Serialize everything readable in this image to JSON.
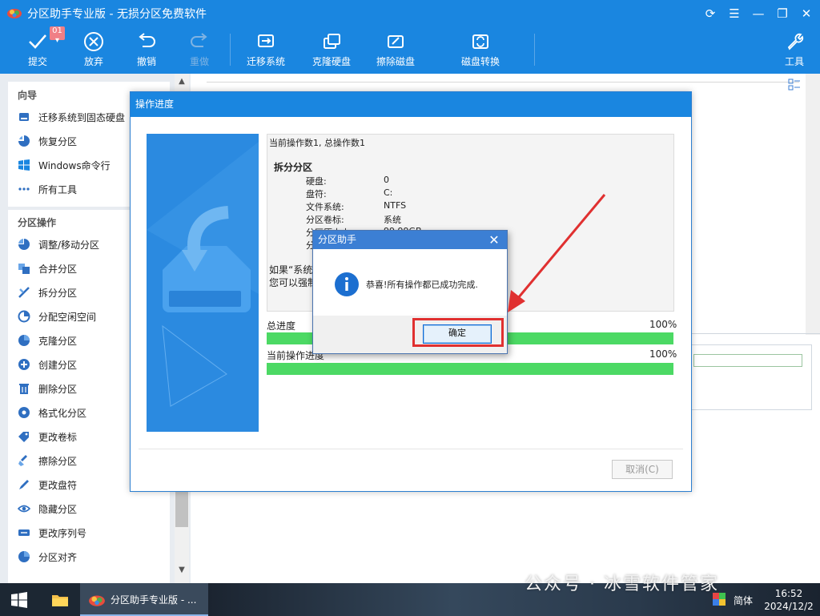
{
  "window": {
    "title": "分区助手专业版 - 无损分区免费软件",
    "controls": [
      "refresh-icon",
      "menu-icon",
      "minimize-icon",
      "restore-icon",
      "close-icon"
    ]
  },
  "toolbar": {
    "commit_label": "提交",
    "pending_badge": "01",
    "discard_label": "放弃",
    "undo_label": "撤销",
    "redo_label": "重做",
    "migrate_label": "迁移系统",
    "clone_label": "克隆硬盘",
    "wipe_label": "擦除磁盘",
    "convert_label": "磁盘转换",
    "tools_label": "工具"
  },
  "sidebar": {
    "wizard_header": "向导",
    "wizard_items": [
      {
        "label": "迁移系统到固态硬盘",
        "icon": "migrate-ssd-icon"
      },
      {
        "label": "恢复分区",
        "icon": "recover-partition-icon"
      },
      {
        "label": "Windows命令行",
        "icon": "windows-icon"
      },
      {
        "label": "所有工具",
        "icon": "more-dots-icon"
      }
    ],
    "ops_header": "分区操作",
    "ops_items": [
      {
        "label": "调整/移动分区",
        "icon": "resize-partition-icon"
      },
      {
        "label": "合并分区",
        "icon": "merge-partition-icon"
      },
      {
        "label": "拆分分区",
        "icon": "split-partition-icon"
      },
      {
        "label": "分配空闲空间",
        "icon": "allocate-space-icon"
      },
      {
        "label": "克隆分区",
        "icon": "clone-partition-icon"
      },
      {
        "label": "创建分区",
        "icon": "create-partition-icon"
      },
      {
        "label": "删除分区",
        "icon": "delete-partition-icon"
      },
      {
        "label": "格式化分区",
        "icon": "format-partition-icon"
      },
      {
        "label": "更改卷标",
        "icon": "label-tag-icon"
      },
      {
        "label": "擦除分区",
        "icon": "wipe-partition-icon"
      },
      {
        "label": "更改盘符",
        "icon": "drive-letter-icon"
      },
      {
        "label": "隐藏分区",
        "icon": "hide-partition-icon"
      },
      {
        "label": "更改序列号",
        "icon": "serial-number-icon"
      },
      {
        "label": "分区对齐",
        "icon": "align-partition-icon"
      }
    ]
  },
  "progress_dialog": {
    "title": "操作进度",
    "log": {
      "current_line": "当前操作数1, 总操作数1",
      "operation": "拆分分区",
      "fields": [
        {
          "key": "硬盘:",
          "value": "0"
        },
        {
          "key": "盘符:",
          "value": "C:"
        },
        {
          "key": "文件系统:",
          "value": "NTFS"
        },
        {
          "key": "分区卷标:",
          "value": "系统"
        },
        {
          "key": "分区原大小:",
          "value": "99.99GB"
        },
        {
          "key": "分",
          "value": ""
        }
      ],
      "note_line1": "如果“系统",
      "note_line2": "您可以强制"
    },
    "total_progress_label": "总进度",
    "total_progress_value": "100%",
    "total_progress_fraction": 1.0,
    "current_progress_label": "当前操作进度",
    "current_progress_value": "100%",
    "current_progress_fraction": 1.0,
    "cancel_label": "取消(C)"
  },
  "message_box": {
    "title": "分区助手",
    "message": "恭喜!所有操作都已成功完成.",
    "ok_label": "确定",
    "highlight_color": "#e03030"
  },
  "taskbar": {
    "app_label": "分区助手专业版 - ...",
    "ime": "简体",
    "time": "16:52",
    "date": "2024/12/2"
  },
  "watermark": "公众号 · 冰雪软件管家",
  "colors": {
    "accent": "#1a86e0",
    "progress": "#4cd964"
  }
}
